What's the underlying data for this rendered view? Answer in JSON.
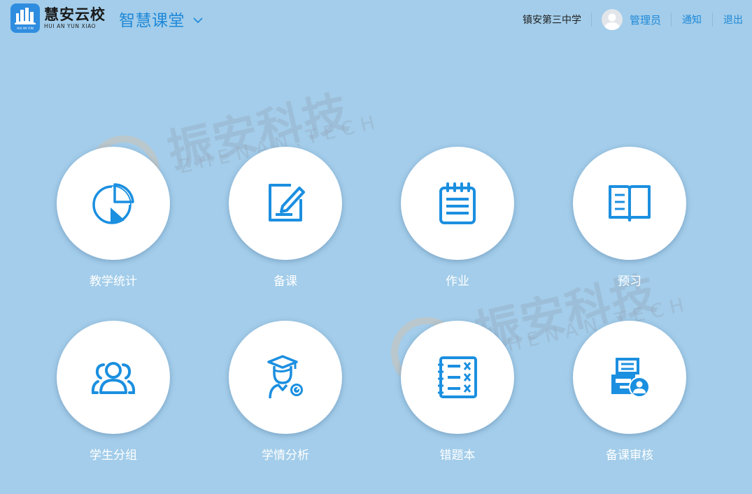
{
  "header": {
    "logo_cn": "慧安云校",
    "logo_en": "HUI AN YUN XIAO",
    "logo_box_text": "HUI AN YUN",
    "app_title": "智慧课堂",
    "school": "镇安第三中学",
    "user_name": "管理员",
    "notify_label": "通知",
    "logout_label": "退出"
  },
  "watermark": {
    "cn": "振安科技",
    "en": "ZHENAN.TECH"
  },
  "tiles": [
    {
      "label": "教学统计",
      "icon": "pie-chart-icon"
    },
    {
      "label": "备课",
      "icon": "edit-note-icon"
    },
    {
      "label": "作业",
      "icon": "notepad-icon"
    },
    {
      "label": "预习",
      "icon": "open-book-icon"
    },
    {
      "label": "学生分组",
      "icon": "group-icon"
    },
    {
      "label": "学情分析",
      "icon": "student-analysis-icon"
    },
    {
      "label": "错题本",
      "icon": "wrong-answers-icon"
    },
    {
      "label": "备课审核",
      "icon": "review-icon"
    }
  ],
  "colors": {
    "background": "#a3cdea",
    "accent": "#1e88d8",
    "icon": "#1b8fe0"
  }
}
